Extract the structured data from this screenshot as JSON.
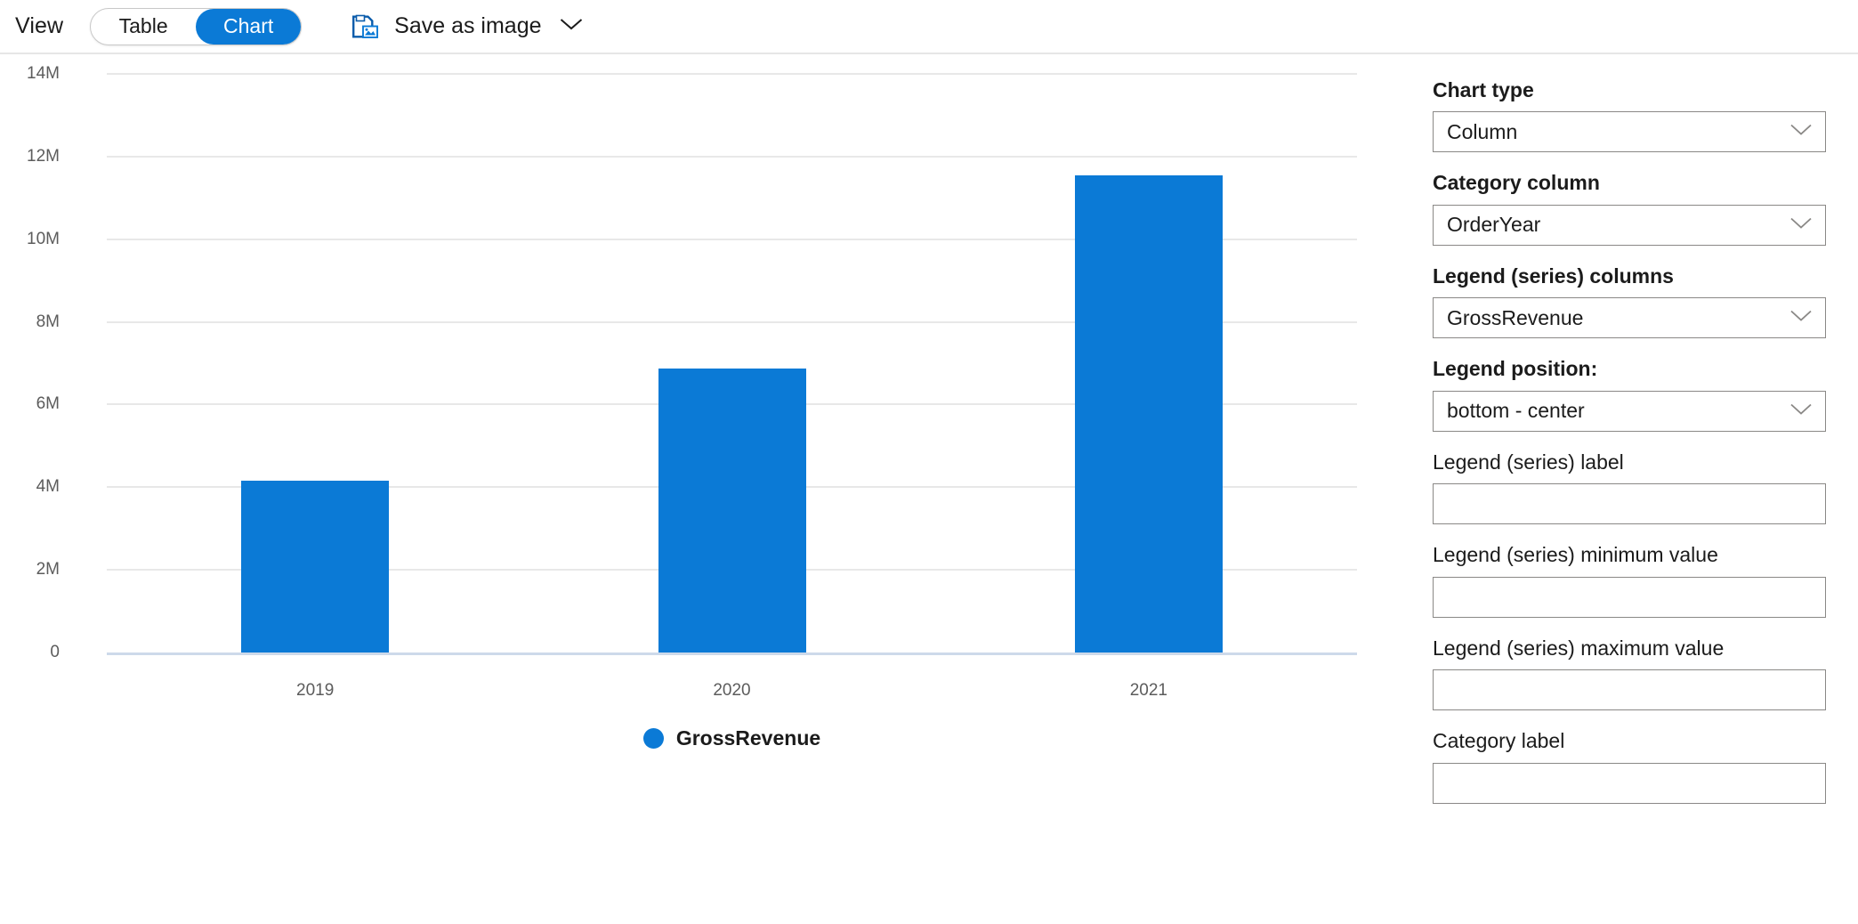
{
  "toolbar": {
    "view_label": "View",
    "toggle": {
      "options": [
        "Table",
        "Chart"
      ],
      "selected": "Chart"
    },
    "save_as_image_label": "Save as image",
    "save_icon": "save-image-icon",
    "chevron_icon": "chevron-down-icon"
  },
  "panel": {
    "fields": [
      {
        "label": "Chart type",
        "type": "select",
        "value": "Column",
        "name": "chart-type"
      },
      {
        "label": "Category column",
        "type": "select",
        "value": "OrderYear",
        "name": "category-column"
      },
      {
        "label": "Legend (series) columns",
        "type": "select",
        "value": "GrossRevenue",
        "name": "legend-series-columns"
      },
      {
        "label": "Legend position:",
        "type": "select",
        "value": "bottom - center",
        "name": "legend-position"
      },
      {
        "label": "Legend (series) label",
        "type": "text",
        "value": "",
        "name": "legend-series-label"
      },
      {
        "label": "Legend (series) minimum value",
        "type": "text",
        "value": "",
        "name": "legend-series-minimum-value"
      },
      {
        "label": "Legend (series) maximum value",
        "type": "text",
        "value": "",
        "name": "legend-series-maximum-value"
      },
      {
        "label": "Category label",
        "type": "text",
        "value": "",
        "name": "category-label"
      }
    ]
  },
  "colors": {
    "accent": "#0b7ad6",
    "bar": "#0b7ad6",
    "gridline": "#e8e8e8",
    "axisline": "#cdd9ea",
    "text": "#1b1b1b",
    "tick_text": "#5c5c5c"
  },
  "chart_data": {
    "type": "bar",
    "title": "",
    "xlabel": "",
    "ylabel": "",
    "categories": [
      "2019",
      "2020",
      "2021"
    ],
    "series": [
      {
        "name": "GrossRevenue",
        "values": [
          4150000,
          6870000,
          11550000
        ],
        "color": "#0b7ad6"
      }
    ],
    "ylim": [
      0,
      14000000
    ],
    "yticks": [
      0,
      2000000,
      4000000,
      6000000,
      8000000,
      10000000,
      12000000,
      14000000
    ],
    "ytick_labels": [
      "0",
      "2M",
      "4M",
      "6M",
      "8M",
      "10M",
      "12M",
      "14M"
    ],
    "grid": true,
    "legend": {
      "entries": [
        "GrossRevenue"
      ],
      "position": "bottom - center"
    }
  }
}
